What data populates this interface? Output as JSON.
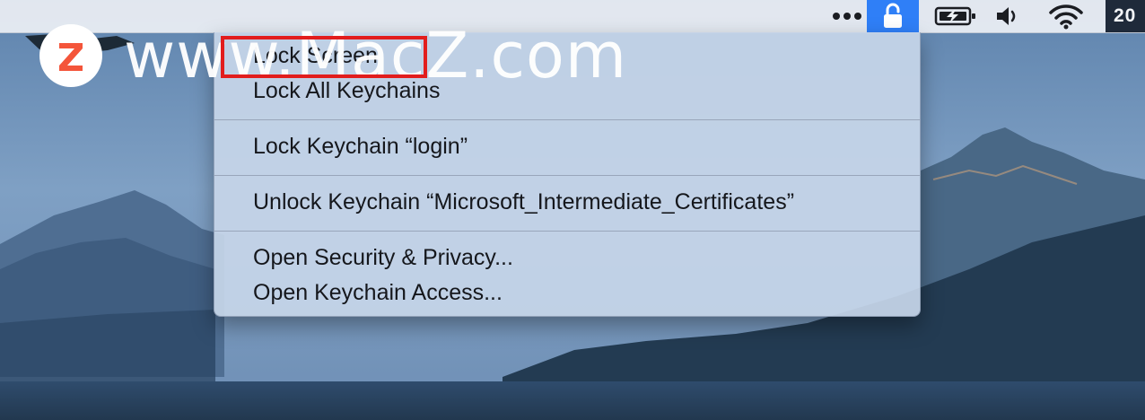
{
  "menubar": {
    "more_icon": "ellipsis-icon",
    "lock_icon": "padlock-unlocked-icon",
    "battery_icon": "battery-charging-icon",
    "volume_icon": "speaker-icon",
    "wifi_icon": "wifi-icon",
    "clock_text": "20",
    "active_color": "#2f7ff7"
  },
  "menu": {
    "items": [
      {
        "label": "Lock Screen"
      },
      {
        "label": "Lock All Keychains"
      },
      {
        "label": "Lock Keychain “login”"
      },
      {
        "label": "Unlock Keychain “Microsoft_Intermediate_Certificates”"
      },
      {
        "label": "Open Security & Privacy..."
      },
      {
        "label": "Open Keychain Access..."
      }
    ]
  },
  "watermark": {
    "badge_letter": "Z",
    "text": "www.MacZ.com",
    "badge_color": "#f4553a"
  },
  "annotation": {
    "color": "#e21d1d"
  }
}
